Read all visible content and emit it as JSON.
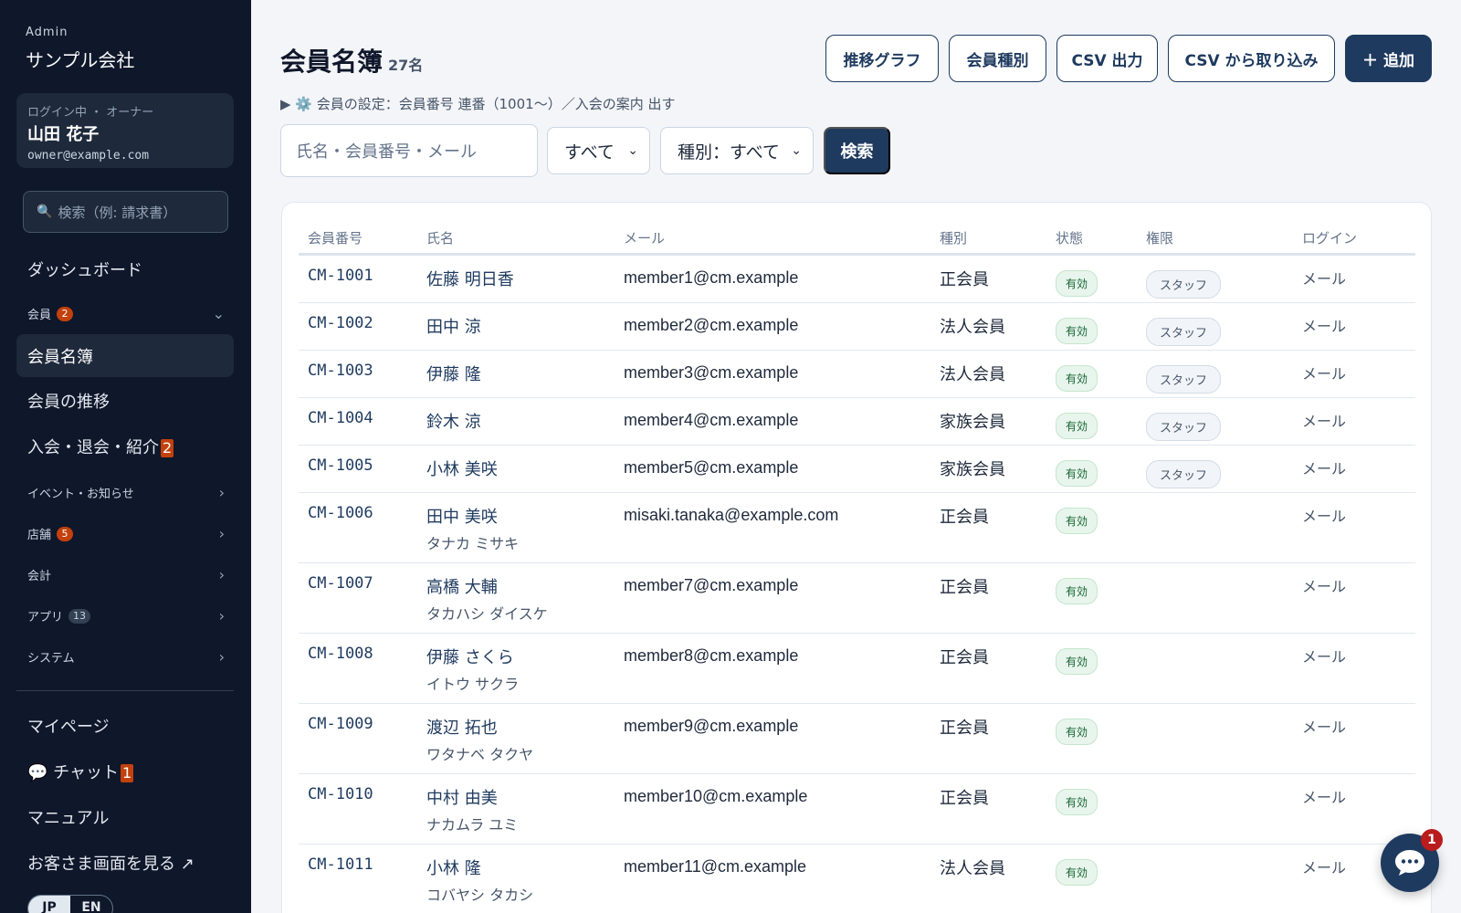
{
  "sidebar": {
    "brand_kicker": "Admin",
    "brand_name": "サンプル会社",
    "user_role": "ログイン中 ・ オーナー",
    "user_name": "山田 花子",
    "user_email": "owner@example.com",
    "search_placeholder": "検索（例: 請求書）",
    "dashboard": "ダッシュボード",
    "members_section": "会員",
    "members_badge": "2",
    "member_list": "会員名簿",
    "member_trend": "会員の推移",
    "join_leave": "入会・退会・紹介",
    "join_leave_badge": "2",
    "events": "イベント・お知らせ",
    "stores": "店舗",
    "stores_badge": "5",
    "accounting": "会計",
    "apps": "アプリ",
    "apps_badge": "13",
    "system": "システム",
    "mypage": "マイページ",
    "chat": "チャット",
    "chat_badge": "1",
    "manual": "マニュアル",
    "customer_view": "お客さま画面を見る ↗",
    "lang_jp": "JP",
    "lang_en": "EN"
  },
  "header": {
    "title": "会員名簿",
    "count": "27名",
    "btn_graph": "推移グラフ",
    "btn_types": "会員種別",
    "btn_csv_out": "CSV 出力",
    "btn_csv_in": "CSV から取り込み",
    "btn_add": "＋ 追加",
    "settings_text": "▶ ⚙️ 会員の設定：会員番号 連番（1001〜）／入会の案内 出す"
  },
  "filters": {
    "search_placeholder": "氏名・会員番号・メール",
    "status_value": "すべて",
    "type_value": "種別：すべて",
    "search_button": "検索"
  },
  "table": {
    "headers": [
      "会員番号",
      "氏名",
      "メール",
      "種別",
      "状態",
      "権限",
      "ログイン"
    ],
    "rows": [
      {
        "id": "CM-1001",
        "name": "佐藤 明日香",
        "kana": "",
        "email": "member1@cm.example",
        "type": "正会員",
        "status": "有効",
        "role": "スタッフ",
        "login": "メール"
      },
      {
        "id": "CM-1002",
        "name": "田中 涼",
        "kana": "",
        "email": "member2@cm.example",
        "type": "法人会員",
        "status": "有効",
        "role": "スタッフ",
        "login": "メール"
      },
      {
        "id": "CM-1003",
        "name": "伊藤 隆",
        "kana": "",
        "email": "member3@cm.example",
        "type": "法人会員",
        "status": "有効",
        "role": "スタッフ",
        "login": "メール"
      },
      {
        "id": "CM-1004",
        "name": "鈴木 涼",
        "kana": "",
        "email": "member4@cm.example",
        "type": "家族会員",
        "status": "有効",
        "role": "スタッフ",
        "login": "メール"
      },
      {
        "id": "CM-1005",
        "name": "小林 美咲",
        "kana": "",
        "email": "member5@cm.example",
        "type": "家族会員",
        "status": "有効",
        "role": "スタッフ",
        "login": "メール"
      },
      {
        "id": "CM-1006",
        "name": "田中 美咲",
        "kana": "タナカ ミサキ",
        "email": "misaki.tanaka@example.com",
        "type": "正会員",
        "status": "有効",
        "role": "",
        "login": "メール"
      },
      {
        "id": "CM-1007",
        "name": "高橋 大輔",
        "kana": "タカハシ ダイスケ",
        "email": "member7@cm.example",
        "type": "正会員",
        "status": "有効",
        "role": "",
        "login": "メール"
      },
      {
        "id": "CM-1008",
        "name": "伊藤 さくら",
        "kana": "イトウ サクラ",
        "email": "member8@cm.example",
        "type": "正会員",
        "status": "有効",
        "role": "",
        "login": "メール"
      },
      {
        "id": "CM-1009",
        "name": "渡辺 拓也",
        "kana": "ワタナベ タクヤ",
        "email": "member9@cm.example",
        "type": "正会員",
        "status": "有効",
        "role": "",
        "login": "メール"
      },
      {
        "id": "CM-1010",
        "name": "中村 由美",
        "kana": "ナカムラ ユミ",
        "email": "member10@cm.example",
        "type": "正会員",
        "status": "有効",
        "role": "",
        "login": "メール"
      },
      {
        "id": "CM-1011",
        "name": "小林 隆",
        "kana": "コバヤシ タカシ",
        "email": "member11@cm.example",
        "type": "法人会員",
        "status": "有効",
        "role": "",
        "login": "メール"
      }
    ]
  },
  "chat_fab": {
    "badge": "1",
    "icon": "chat-bubble-icon"
  },
  "colors": {
    "sidebar_bg": "#0f172a",
    "primary": "#1e3a5f",
    "badge": "#c2410c",
    "status_ok": "#166534"
  }
}
